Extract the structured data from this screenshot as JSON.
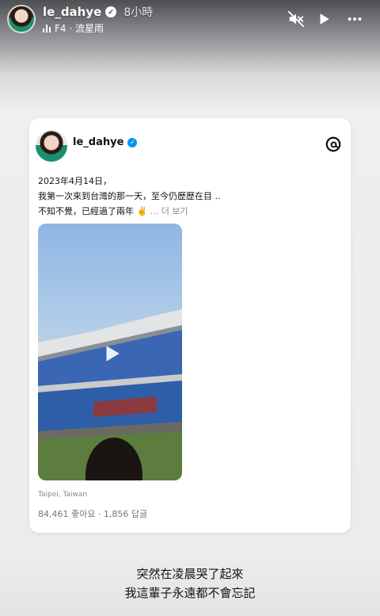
{
  "story": {
    "username": "le_dahye",
    "time": "8小時",
    "music": "F4 · 流星雨",
    "icons": {
      "mute": "speaker-muted-icon",
      "play": "play-icon",
      "more": "more-horizontal-icon"
    }
  },
  "card": {
    "username": "le_dahye",
    "text_line1": "2023年4月14日，",
    "text_line2": "我第一次來到台灣的那一天，至今仍歷歷在目 ..",
    "text_line3": "不知不覺，已經過了兩年",
    "emoji": "✌️",
    "more_label": "... 더 보기",
    "location": "Taipei, Taiwan",
    "stats": "84,461 좋아요 · 1,856 답글"
  },
  "caption": {
    "line1": "突然在凌晨哭了起來",
    "line2": "我這輩子永遠都不會忘記"
  }
}
